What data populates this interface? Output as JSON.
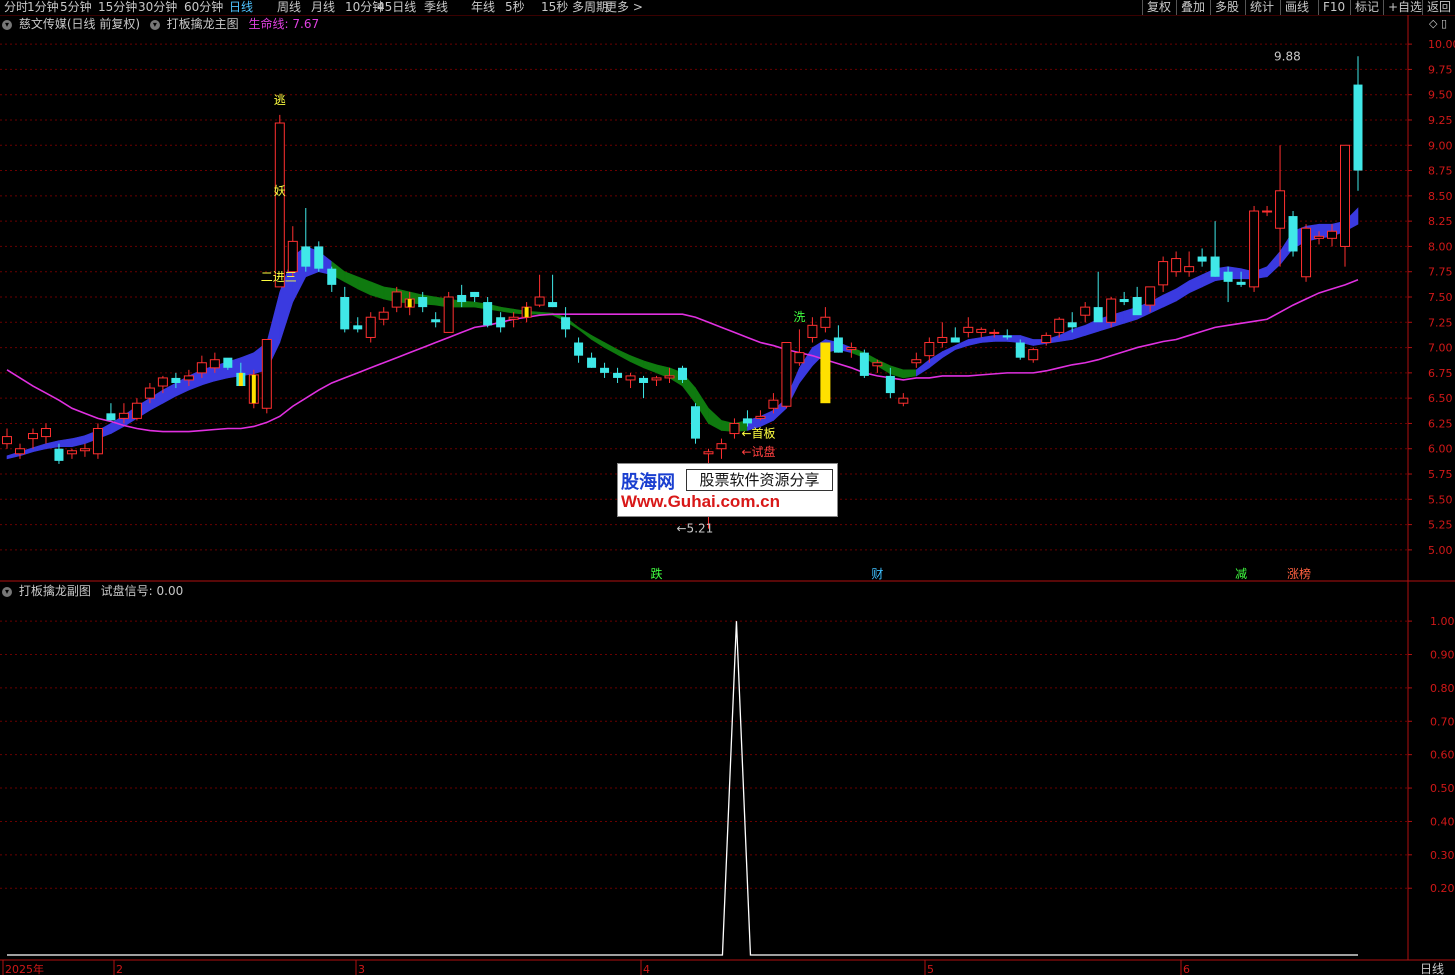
{
  "toolbar": {
    "periods": [
      "分时",
      "1分钟",
      "5分钟",
      "15分钟",
      "30分钟",
      "60分钟",
      "日线",
      "周线",
      "月线",
      "10分钟",
      "45日线",
      "季线",
      "年线",
      "5秒",
      "15秒",
      "多周期",
      "更多 >"
    ],
    "active_period": "日线",
    "right_buttons": [
      "复权",
      "叠加",
      "多股",
      "统计",
      "画线",
      "F10",
      "标记",
      "+自选",
      "返回"
    ]
  },
  "main_legend": {
    "stock": "慈文传媒(日线 前复权)",
    "indicator": "打板擒龙主图",
    "lifeline_label": "生命线: 7.67"
  },
  "sub_legend": {
    "indicator": "打板擒龙副图",
    "signal_label": "试盘信号: 0.00"
  },
  "watermark": {
    "brand": "股海网",
    "slogan": "股票软件资源分享",
    "url": "Www.Guhai.com.cn"
  },
  "bottom_axis": {
    "labels": [
      "2025年",
      "2",
      "3",
      "4",
      "5",
      "6"
    ],
    "period_button": "日线"
  },
  "chart_data": [
    {
      "type": "candlestick",
      "title": "打板擒龙主图",
      "ylim": [
        4.9,
        10.1
      ],
      "yticks": [
        "10.00",
        "9.75",
        "9.50",
        "9.25",
        "9.00",
        "8.75",
        "8.50",
        "8.25",
        "8.00",
        "7.75",
        "7.50",
        "7.25",
        "7.00",
        "6.75",
        "6.50",
        "6.25",
        "6.00",
        "5.75",
        "5.50",
        "5.25",
        "5.00"
      ],
      "ohlc": [
        [
          6.05,
          6.2,
          6.0,
          6.12
        ],
        [
          5.95,
          6.05,
          5.9,
          6.0
        ],
        [
          6.1,
          6.2,
          6.0,
          6.15
        ],
        [
          6.12,
          6.25,
          6.05,
          6.2
        ],
        [
          6.0,
          6.05,
          5.85,
          5.88
        ],
        [
          5.95,
          6.0,
          5.9,
          5.98
        ],
        [
          5.98,
          6.05,
          5.92,
          6.0
        ],
        [
          5.95,
          6.25,
          5.9,
          6.2
        ],
        [
          6.35,
          6.45,
          6.28,
          6.28
        ],
        [
          6.3,
          6.45,
          6.25,
          6.35
        ],
        [
          6.3,
          6.5,
          6.28,
          6.45
        ],
        [
          6.5,
          6.65,
          6.45,
          6.6
        ],
        [
          6.62,
          6.72,
          6.55,
          6.7
        ],
        [
          6.7,
          6.75,
          6.6,
          6.65
        ],
        [
          6.68,
          6.78,
          6.62,
          6.72
        ],
        [
          6.75,
          6.92,
          6.7,
          6.85
        ],
        [
          6.8,
          6.95,
          6.75,
          6.88
        ],
        [
          6.9,
          6.88,
          6.78,
          6.8
        ],
        [
          6.75,
          6.85,
          6.7,
          6.62
        ],
        [
          6.45,
          6.78,
          6.4,
          6.73
        ],
        [
          6.4,
          7.08,
          6.35,
          7.08
        ],
        [
          7.6,
          9.3,
          7.6,
          9.22
        ],
        [
          7.75,
          8.2,
          7.7,
          8.05
        ],
        [
          8.0,
          8.38,
          7.75,
          7.8
        ],
        [
          8.0,
          8.05,
          7.75,
          7.78
        ],
        [
          7.78,
          7.8,
          7.55,
          7.62
        ],
        [
          7.5,
          7.6,
          7.15,
          7.18
        ],
        [
          7.22,
          7.3,
          7.15,
          7.18
        ],
        [
          7.1,
          7.35,
          7.05,
          7.3
        ],
        [
          7.28,
          7.4,
          7.22,
          7.35
        ],
        [
          7.4,
          7.6,
          7.35,
          7.55
        ],
        [
          7.4,
          7.55,
          7.32,
          7.48
        ],
        [
          7.5,
          7.55,
          7.35,
          7.4
        ],
        [
          7.28,
          7.35,
          7.2,
          7.25
        ],
        [
          7.15,
          7.55,
          7.15,
          7.5
        ],
        [
          7.52,
          7.62,
          7.4,
          7.45
        ],
        [
          7.55,
          7.55,
          7.45,
          7.5
        ],
        [
          7.45,
          7.5,
          7.2,
          7.22
        ],
        [
          7.3,
          7.35,
          7.15,
          7.2
        ],
        [
          7.28,
          7.35,
          7.2,
          7.3
        ],
        [
          7.3,
          7.45,
          7.25,
          7.4
        ],
        [
          7.42,
          7.72,
          7.4,
          7.5
        ],
        [
          7.45,
          7.72,
          7.4,
          7.4
        ],
        [
          7.3,
          7.4,
          7.1,
          7.18
        ],
        [
          7.05,
          7.1,
          6.85,
          6.92
        ],
        [
          6.9,
          6.95,
          6.8,
          6.8
        ],
        [
          6.8,
          6.85,
          6.7,
          6.75
        ],
        [
          6.75,
          6.8,
          6.65,
          6.7
        ],
        [
          6.68,
          6.75,
          6.6,
          6.72
        ],
        [
          6.7,
          6.72,
          6.5,
          6.65
        ],
        [
          6.68,
          6.72,
          6.62,
          6.7
        ],
        [
          6.7,
          6.8,
          6.65,
          6.72
        ],
        [
          6.8,
          6.82,
          6.65,
          6.68
        ],
        [
          6.42,
          6.45,
          6.05,
          6.1
        ],
        [
          5.95,
          6.0,
          5.21,
          5.97
        ],
        [
          6.0,
          6.1,
          5.9,
          6.05
        ],
        [
          6.15,
          6.3,
          6.1,
          6.25
        ],
        [
          6.3,
          6.38,
          6.22,
          6.25
        ],
        [
          6.3,
          6.38,
          6.28,
          6.32
        ],
        [
          6.4,
          6.55,
          6.35,
          6.48
        ],
        [
          6.42,
          7.05,
          6.4,
          7.05
        ],
        [
          6.85,
          7.18,
          6.82,
          6.95
        ],
        [
          7.1,
          7.3,
          7.05,
          7.22
        ],
        [
          7.2,
          7.4,
          7.15,
          7.3
        ],
        [
          7.1,
          7.22,
          6.95,
          6.95
        ],
        [
          6.98,
          7.05,
          6.9,
          7.0
        ],
        [
          6.95,
          6.98,
          6.7,
          6.72
        ],
        [
          6.82,
          6.88,
          6.75,
          6.85
        ],
        [
          6.72,
          6.8,
          6.5,
          6.55
        ],
        [
          6.45,
          6.55,
          6.42,
          6.5
        ],
        [
          6.85,
          6.95,
          6.8,
          6.88
        ],
        [
          6.92,
          7.1,
          6.85,
          7.05
        ],
        [
          7.05,
          7.25,
          7.0,
          7.1
        ],
        [
          7.1,
          7.2,
          7.05,
          7.05
        ],
        [
          7.15,
          7.3,
          7.1,
          7.2
        ],
        [
          7.15,
          7.2,
          7.1,
          7.18
        ],
        [
          7.15,
          7.18,
          7.1,
          7.15
        ],
        [
          7.12,
          7.18,
          7.08,
          7.1
        ],
        [
          7.05,
          7.08,
          6.88,
          6.9
        ],
        [
          6.88,
          7.0,
          6.85,
          6.98
        ],
        [
          7.05,
          7.15,
          7.02,
          7.12
        ],
        [
          7.15,
          7.3,
          7.1,
          7.28
        ],
        [
          7.25,
          7.35,
          7.15,
          7.2
        ],
        [
          7.32,
          7.45,
          7.25,
          7.4
        ],
        [
          7.4,
          7.75,
          7.3,
          7.25
        ],
        [
          7.25,
          7.5,
          7.2,
          7.48
        ],
        [
          7.48,
          7.55,
          7.42,
          7.45
        ],
        [
          7.5,
          7.6,
          7.35,
          7.32
        ],
        [
          7.42,
          7.6,
          7.35,
          7.6
        ],
        [
          7.62,
          7.9,
          7.55,
          7.85
        ],
        [
          7.75,
          7.95,
          7.7,
          7.88
        ],
        [
          7.75,
          7.95,
          7.7,
          7.8
        ],
        [
          7.9,
          7.98,
          7.8,
          7.85
        ],
        [
          7.9,
          8.25,
          7.7,
          7.7
        ],
        [
          7.75,
          7.8,
          7.45,
          7.65
        ],
        [
          7.65,
          7.75,
          7.6,
          7.62
        ],
        [
          7.6,
          8.4,
          7.55,
          8.35
        ],
        [
          8.35,
          8.4,
          8.3,
          8.35
        ],
        [
          8.18,
          9.0,
          7.8,
          8.55
        ],
        [
          8.3,
          8.35,
          7.9,
          7.95
        ],
        [
          7.7,
          8.22,
          7.65,
          8.18
        ],
        [
          8.08,
          8.15,
          8.02,
          8.1
        ],
        [
          8.08,
          8.22,
          8.0,
          8.15
        ],
        [
          8.0,
          9.0,
          7.8,
          9.0
        ],
        [
          9.6,
          9.88,
          8.55,
          8.75
        ]
      ],
      "lifeline": [
        6.78,
        6.7,
        6.62,
        6.55,
        6.48,
        6.4,
        6.35,
        6.3,
        6.27,
        6.23,
        6.2,
        6.18,
        6.17,
        6.17,
        6.17,
        6.18,
        6.19,
        6.2,
        6.2,
        6.22,
        6.26,
        6.32,
        6.42,
        6.5,
        6.58,
        6.65,
        6.7,
        6.75,
        6.8,
        6.85,
        6.9,
        6.95,
        7.0,
        7.05,
        7.1,
        7.15,
        7.2,
        7.22,
        7.25,
        7.28,
        7.3,
        7.32,
        7.33,
        7.33,
        7.33,
        7.33,
        7.33,
        7.33,
        7.33,
        7.33,
        7.33,
        7.33,
        7.33,
        7.3,
        7.25,
        7.2,
        7.15,
        7.1,
        7.05,
        7.02,
        6.98,
        6.95,
        6.92,
        6.88,
        6.84,
        6.8,
        6.75,
        6.72,
        6.7,
        6.68,
        6.7,
        6.7,
        6.72,
        6.72,
        6.72,
        6.73,
        6.74,
        6.75,
        6.75,
        6.75,
        6.77,
        6.8,
        6.83,
        6.85,
        6.88,
        6.92,
        6.96,
        7.0,
        7.03,
        7.06,
        7.08,
        7.12,
        7.16,
        7.2,
        7.22,
        7.24,
        7.26,
        7.28,
        7.35,
        7.42,
        7.48,
        7.54,
        7.58,
        7.62,
        7.67
      ],
      "band_upper": [
        5.93,
        5.97,
        6.01,
        6.05,
        6.08,
        6.1,
        6.13,
        6.18,
        6.25,
        6.33,
        6.42,
        6.5,
        6.58,
        6.65,
        6.72,
        6.78,
        6.82,
        6.86,
        6.9,
        6.95,
        7.05,
        7.55,
        7.9,
        8.0,
        7.95,
        7.85,
        7.75,
        7.7,
        7.65,
        7.6,
        7.58,
        7.55,
        7.52,
        7.5,
        7.48,
        7.46,
        7.45,
        7.43,
        7.4,
        7.38,
        7.36,
        7.35,
        7.34,
        7.3,
        7.2,
        7.12,
        7.05,
        6.98,
        6.92,
        6.87,
        6.83,
        6.8,
        6.75,
        6.6,
        6.4,
        6.28,
        6.25,
        6.28,
        6.32,
        6.38,
        6.5,
        6.8,
        7.0,
        7.08,
        7.05,
        7.0,
        6.95,
        6.88,
        6.82,
        6.78,
        6.78,
        6.88,
        6.96,
        7.02,
        7.08,
        7.1,
        7.12,
        7.12,
        7.12,
        7.08,
        7.08,
        7.12,
        7.18,
        7.22,
        7.28,
        7.32,
        7.36,
        7.4,
        7.45,
        7.52,
        7.58,
        7.66,
        7.72,
        7.78,
        7.8,
        7.78,
        7.75,
        7.8,
        7.95,
        8.15,
        8.2,
        8.22,
        8.22,
        8.25,
        8.38,
        8.48
      ],
      "band_lower": [
        5.9,
        5.93,
        5.97,
        6.0,
        6.02,
        6.02,
        6.05,
        6.1,
        6.15,
        6.22,
        6.3,
        6.38,
        6.45,
        6.52,
        6.58,
        6.63,
        6.67,
        6.7,
        6.72,
        6.74,
        6.78,
        7.05,
        7.45,
        7.7,
        7.75,
        7.72,
        7.65,
        7.58,
        7.52,
        7.48,
        7.45,
        7.44,
        7.43,
        7.42,
        7.4,
        7.4,
        7.4,
        7.38,
        7.36,
        7.34,
        7.33,
        7.33,
        7.32,
        7.26,
        7.18,
        7.08,
        7.0,
        6.93,
        6.86,
        6.8,
        6.75,
        6.7,
        6.62,
        6.45,
        6.25,
        6.18,
        6.17,
        6.18,
        6.22,
        6.28,
        6.4,
        6.65,
        6.82,
        6.95,
        6.98,
        6.95,
        6.9,
        6.82,
        6.74,
        6.7,
        6.72,
        6.8,
        6.9,
        6.98,
        7.02,
        7.05,
        7.06,
        7.06,
        7.05,
        7.02,
        7.04,
        7.06,
        7.08,
        7.12,
        7.16,
        7.2,
        7.24,
        7.28,
        7.34,
        7.4,
        7.46,
        7.54,
        7.6,
        7.66,
        7.68,
        7.68,
        7.68,
        7.7,
        7.82,
        7.98,
        8.05,
        8.08,
        8.1,
        8.15,
        8.22,
        8.3
      ],
      "band_color": [
        "blue",
        "blue",
        "blue",
        "blue",
        "blue",
        "blue",
        "blue",
        "blue",
        "blue",
        "blue",
        "blue",
        "blue",
        "blue",
        "blue",
        "blue",
        "blue",
        "blue",
        "blue",
        "blue",
        "blue",
        "blue",
        "blue",
        "blue",
        "blue",
        "blue",
        "green",
        "green",
        "green",
        "green",
        "green",
        "green",
        "green",
        "green",
        "green",
        "green",
        "green",
        "green",
        "green",
        "green",
        "green",
        "green",
        "green",
        "green",
        "green",
        "green",
        "green",
        "green",
        "green",
        "green",
        "green",
        "green",
        "green",
        "green",
        "green",
        "green",
        "green",
        "green",
        "blue",
        "blue",
        "blue",
        "blue",
        "blue",
        "blue",
        "blue",
        "blue",
        "green",
        "green",
        "green",
        "green",
        "green",
        "blue",
        "blue",
        "blue",
        "blue",
        "blue",
        "blue",
        "blue",
        "blue",
        "blue",
        "blue",
        "blue",
        "blue",
        "blue",
        "blue",
        "blue",
        "blue",
        "blue",
        "blue",
        "blue",
        "blue",
        "blue",
        "blue",
        "blue",
        "blue",
        "blue",
        "blue",
        "blue",
        "blue",
        "blue",
        "blue",
        "blue",
        "blue",
        "blue",
        "blue",
        "blue"
      ],
      "yellow_highlights": [
        18,
        19,
        31,
        40,
        63
      ],
      "annotations": [
        {
          "text": "逃",
          "x": 21,
          "y": 9.45,
          "color": "#ffff40"
        },
        {
          "text": "妖",
          "x": 21,
          "y": 8.55,
          "color": "#ffff40"
        },
        {
          "text": "二进三",
          "x": 20,
          "y": 7.7,
          "color": "#ffff40"
        },
        {
          "text": "洗",
          "x": 61,
          "y": 7.3,
          "color": "#40ff40"
        },
        {
          "text": "←首板",
          "x": 57,
          "y": 6.15,
          "color": "#ffff40"
        },
        {
          "text": "←试盘",
          "x": 57,
          "y": 5.97,
          "color": "#ff4040"
        },
        {
          "text": "←5.21",
          "x": 52,
          "y": 5.21,
          "color": "#c8c8c8"
        },
        {
          "text": "9.88",
          "x": 98,
          "y": 9.88,
          "color": "#c8c8c8"
        }
      ],
      "tags": [
        {
          "text": "跌",
          "x": 50,
          "color": "#40ff40"
        },
        {
          "text": "财",
          "x": 67,
          "color": "#40c0ff"
        },
        {
          "text": "减",
          "x": 95,
          "color": "#40ff40"
        },
        {
          "text": "涨榜",
          "x": 99,
          "color": "#ff6040"
        }
      ]
    },
    {
      "type": "line",
      "title": "打板擒龙副图",
      "ylim": [
        0,
        1.05
      ],
      "yticks": [
        "1.00",
        "0.90",
        "0.80",
        "0.70",
        "0.60",
        "0.50",
        "0.40",
        "0.30",
        "0.20"
      ],
      "series": [
        {
          "name": "试盘信号",
          "spike_index": 57,
          "spike_value": 1.0,
          "base_value": 0.0
        }
      ]
    }
  ]
}
